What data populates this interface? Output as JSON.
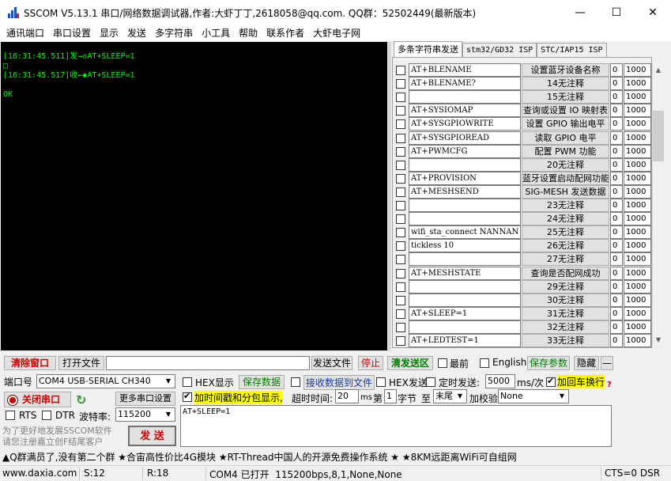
{
  "window": {
    "title": "SSCOM V5.13.1 串口/网络数据调试器,作者:大虾丁丁,2618058@qq.com. QQ群：52502449(最新版本)",
    "app_icon": "sscom-app-icon",
    "minimize": "—",
    "maximize": "☐",
    "close": "✕"
  },
  "menu": [
    "通讯端口",
    "串口设置",
    "显示",
    "发送",
    "多字符串",
    "小工具",
    "帮助",
    "联系作者",
    "大虾电子网"
  ],
  "terminal": {
    "lines": [
      "[16:31:45.511]发→◇AT+SLEEP=1",
      "□",
      "[16:31:45.517]收←◆AT+SLEEP=1",
      "",
      "OK"
    ]
  },
  "tabs": [
    "多条字符串发送",
    "stm32/GD32 ISP",
    "STC/IAP15 ISP"
  ],
  "rows": [
    {
      "cmd": "AT+BLENAME",
      "label": "设置蓝牙设备名称",
      "n1": "0",
      "n2": "1000"
    },
    {
      "cmd": "AT+BLENAME?",
      "label": "14无注释",
      "n1": "0",
      "n2": "1000"
    },
    {
      "cmd": "",
      "label": "15无注释",
      "n1": "0",
      "n2": "1000"
    },
    {
      "cmd": "AT+SYSIOMAP",
      "label": "查询或设置 IO 映射表",
      "n1": "0",
      "n2": "1000"
    },
    {
      "cmd": "AT+SYSGPIOWRITE",
      "label": "设置 GPIO 输出电平",
      "n1": "0",
      "n2": "1000"
    },
    {
      "cmd": "AT+SYSGPIOREAD",
      "label": "读取 GPIO 电平",
      "n1": "0",
      "n2": "1000"
    },
    {
      "cmd": "AT+PWMCFG",
      "label": "配置 PWM 功能",
      "n1": "0",
      "n2": "1000"
    },
    {
      "cmd": "",
      "label": "20无注释",
      "n1": "0",
      "n2": "1000"
    },
    {
      "cmd": "AT+PROVISION",
      "label": "蓝牙设置启动配网功能",
      "n1": "0",
      "n2": "1000"
    },
    {
      "cmd": "AT+MESHSEND",
      "label": "SIG-MESH 发送数据",
      "n1": "0",
      "n2": "1000"
    },
    {
      "cmd": "",
      "label": "23无注释",
      "n1": "0",
      "n2": "1000"
    },
    {
      "cmd": "",
      "label": "24无注释",
      "n1": "0",
      "n2": "1000"
    },
    {
      "cmd": "wifi_sta_connect NANNAN",
      "label": "25无注释",
      "n1": "0",
      "n2": "1000"
    },
    {
      "cmd": "tickless 10",
      "label": "26无注释",
      "n1": "0",
      "n2": "1000"
    },
    {
      "cmd": "",
      "label": "27无注释",
      "n1": "0",
      "n2": "1000"
    },
    {
      "cmd": "AT+MESHSTATE",
      "label": "查询是否配网成功",
      "n1": "0",
      "n2": "1000"
    },
    {
      "cmd": "",
      "label": "29无注释",
      "n1": "0",
      "n2": "1000"
    },
    {
      "cmd": "",
      "label": "30无注释",
      "n1": "0",
      "n2": "1000"
    },
    {
      "cmd": "AT+SLEEP=1",
      "label": "31无注释",
      "n1": "0",
      "n2": "1000"
    },
    {
      "cmd": "",
      "label": "32无注释",
      "n1": "0",
      "n2": "1000"
    },
    {
      "cmd": "AT+LEDTEST=1",
      "label": "33无注释",
      "n1": "0",
      "n2": "1000"
    }
  ],
  "toolbar": {
    "clear_window": "清除窗口",
    "open_file": "打开文件",
    "send_file": "发送文件",
    "stop": "停止",
    "clear_send": "清发送区",
    "topmost": "最前",
    "english": "English",
    "save_params": "保存参数",
    "hide": "隐藏",
    "minimize": "—"
  },
  "port": {
    "label": "端口号",
    "value": "COM4 USB-SERIAL CH340",
    "close_port": "关闭串口",
    "more_settings": "更多串口设置",
    "rts": "RTS",
    "dtr": "DTR",
    "baud_label": "波特率:",
    "baud_value": "115200"
  },
  "options": {
    "hex_display": "HEX显示",
    "save_data": "保存数据",
    "recv_to_file": "接收数据到文件",
    "hex_send": "HEX发送",
    "timed_send": "定时发送:",
    "interval": "5000",
    "interval_unit": "ms/次",
    "add_crlf": "加回车换行",
    "timestamp": "加时间戳和分包显示,",
    "timeout_label": "超时时间:",
    "timeout": "20",
    "timeout_unit": "ms",
    "byte_nth": "第",
    "byte_index": "1",
    "byte_unit": "字节",
    "to_label": "至",
    "to_value": "末尾",
    "checksum_label": "加校验",
    "checksum_value": "None",
    "help_mark": "?"
  },
  "send": {
    "text": "AT+SLEEP=1",
    "button": "发 送"
  },
  "promo": {
    "left": "为了更好地发展SSCOM软件\n请您注册嘉立创F结尾客户",
    "ticker": "▲Q群满员了,没有第二个群 ★合宙高性价比4G模块 ★RT-Thread中国人的开源免费操作系统 ★ ★8KM远距离WiFi可自组网"
  },
  "status": {
    "website": "www.daxia.com",
    "sent": "S:12",
    "received": "R:18",
    "port_status": "COM4 已打开  115200bps,8,1,None,None",
    "signals": "CTS=0 DSR"
  },
  "colors": {
    "terminal_bg": "#000000",
    "terminal_fg": "#00ff00",
    "highlight_yellow": "#ffff00",
    "accent_red": "#cc0000",
    "accent_green": "#008000"
  }
}
